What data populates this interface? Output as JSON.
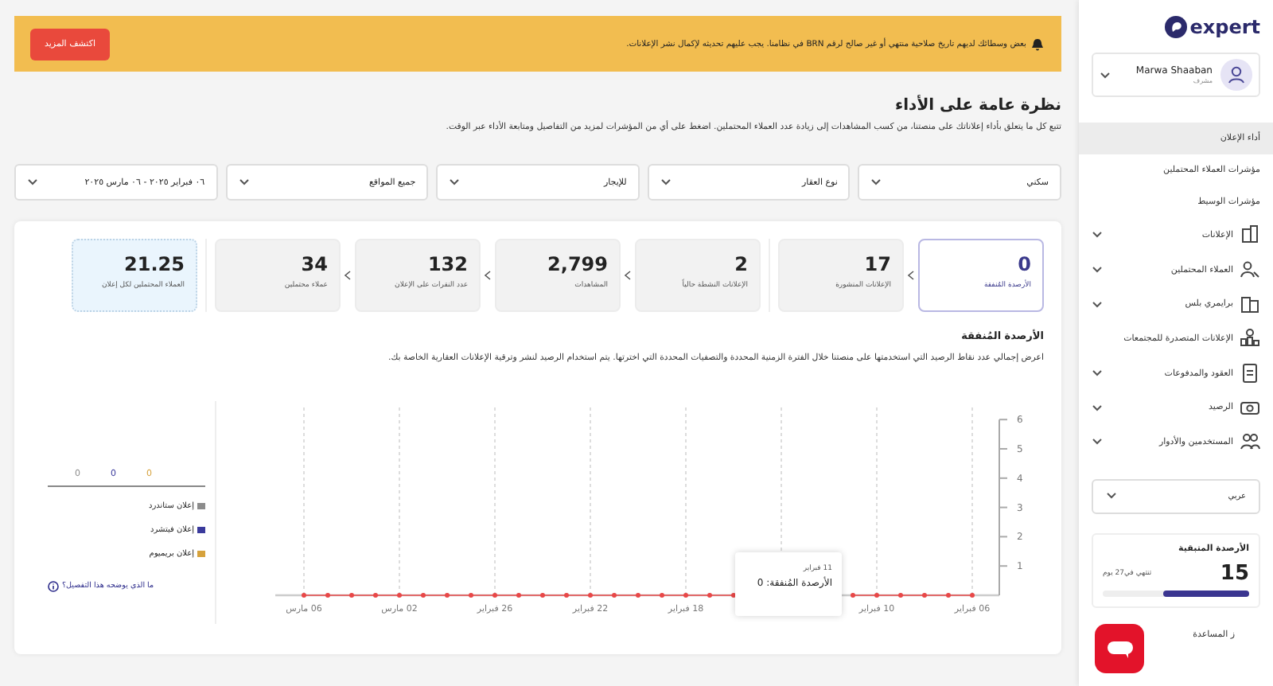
{
  "sidebar": {
    "logo": "expert",
    "user": {
      "name": "Marwa Shaaban",
      "role": "مشرف"
    },
    "items": [
      {
        "label": "أداء الإعلان",
        "selected": true,
        "has_submenu": false,
        "kind": "link"
      },
      {
        "label": "مؤشرات العملاء المحتملين",
        "selected": false,
        "has_submenu": false,
        "kind": "link"
      },
      {
        "label": "مؤشرات الوسيط",
        "selected": false,
        "has_submenu": false,
        "kind": "link"
      },
      {
        "label": "الإعلانات",
        "selected": false,
        "has_submenu": true,
        "kind": "menu"
      },
      {
        "label": "العملاء المحتملين",
        "selected": false,
        "has_submenu": true,
        "kind": "menu"
      },
      {
        "label": "برايمري بلس",
        "selected": false,
        "has_submenu": true,
        "kind": "menu"
      },
      {
        "label": "الإعلانات المتصدرة للمجتمعات",
        "selected": false,
        "has_submenu": false,
        "kind": "menu"
      },
      {
        "label": "العقود والمدفوعات",
        "selected": false,
        "has_submenu": true,
        "kind": "menu"
      },
      {
        "label": "الرصيد",
        "selected": false,
        "has_submenu": true,
        "kind": "menu"
      },
      {
        "label": "المستخدمين والأدوار",
        "selected": false,
        "has_submenu": true,
        "kind": "menu"
      }
    ],
    "language": "عربي",
    "credits": {
      "title": "الأرصدة المتبقية",
      "amount": "15",
      "expiry": "تنتهي في27 يوم",
      "level": 0.59
    },
    "help": "ز المساعدة"
  },
  "banner": {
    "text": "بعض وسطائك لديهم تاريخ صلاحية منتهي أو غير صالح لرقم BRN في نظامنا. يجب عليهم تحديثه لإكمال نشر الإعلانات.",
    "button": "اكتشف المزيد"
  },
  "title": "نظرة عامة على الأداء",
  "description": "تتبع كل ما يتعلق بأداء إعلاناتك على منصتنا، من كسب المشاهدات إلى زيادة عدد العملاء المحتملين. اضغط على أي من المؤشرات لمزيد من التفاصيل ومتابعة الأداء عبر الوقت.",
  "filters": [
    "سكني",
    "نوع العقار",
    "للإيجار",
    "جميع المواقع",
    "٠٦ فبراير ٢٠٢٥ - ٠٦ مارس ٢٠٢٥"
  ],
  "metric_groups": [
    [
      {
        "value": "0",
        "label": "الأرصدة المُنفقة",
        "selected": true,
        "kind": "count"
      },
      {
        "value": "17",
        "label": "الإعلانات المنشورة",
        "selected": false,
        "kind": "count"
      }
    ],
    [
      {
        "value": "2",
        "label": "الإعلانات النشطة حالياً",
        "selected": false,
        "kind": "count"
      },
      {
        "value": "2,799",
        "label": "المشاهدات",
        "selected": false,
        "kind": "count"
      },
      {
        "value": "132",
        "label": "عدد النقرات على الإعلان",
        "selected": false,
        "kind": "count"
      },
      {
        "value": "34",
        "label": "عملاء محتملين",
        "selected": false,
        "kind": "count"
      }
    ],
    [
      {
        "value": "21.25",
        "label": "العملاء المحتملين لكل إعلان",
        "selected": false,
        "kind": "ratio"
      }
    ]
  ],
  "chart_section": {
    "title": "الأرصدة المُنفقة",
    "description": "اعرض إجمالي عدد نقاط الرصيد التي استخدمتها على منصتنا خلال الفترة الزمنية المحددة والتصفيات المحددة التي اخترتها. يتم استخدام الرصيد لنشر وترقية الإعلانات العقارية الخاصة بك.",
    "chart_data": {
      "type": "line",
      "grid": true,
      "categories": [
        "06 مارس",
        null,
        null,
        null,
        "02 مارس",
        null,
        null,
        null,
        "26 فبراير",
        null,
        null,
        null,
        "22 فبراير",
        null,
        null,
        null,
        "18 فبراير",
        null,
        null,
        null,
        null,
        null,
        null,
        null,
        "10 فبراير",
        null,
        null,
        null,
        "06 فبراير"
      ],
      "series": [
        {
          "color": "#e84848",
          "marker": "circle",
          "values": [
            0,
            0,
            0,
            0,
            0,
            0,
            0,
            0,
            0,
            0,
            0,
            0,
            0,
            0,
            0,
            0,
            0,
            0,
            0,
            null,
            null,
            null,
            null,
            0,
            0,
            0,
            0,
            0,
            0
          ]
        }
      ],
      "ylim": [
        0,
        6
      ],
      "yticks": [
        1,
        2,
        3,
        4,
        5,
        6
      ]
    },
    "tooltip": {
      "date": "11 فبراير",
      "text": "الأرصدة المُنفقة: 0"
    },
    "totals": [
      {
        "value": "0",
        "color": "#d6a23c"
      },
      {
        "value": "0",
        "color": "#3a3a9c"
      },
      {
        "value": "0",
        "color": "#8c8c8c"
      }
    ],
    "breakdown": [
      {
        "label": "إعلان ستاندرد",
        "color": "#8c8c8c"
      },
      {
        "label": "إعلان فيتشرد",
        "color": "#3a3a9c"
      },
      {
        "label": "إعلان بريميوم",
        "color": "#d6a23c"
      }
    ],
    "info_link": "ما الذي يوضحه هذا التفصيل؟"
  }
}
